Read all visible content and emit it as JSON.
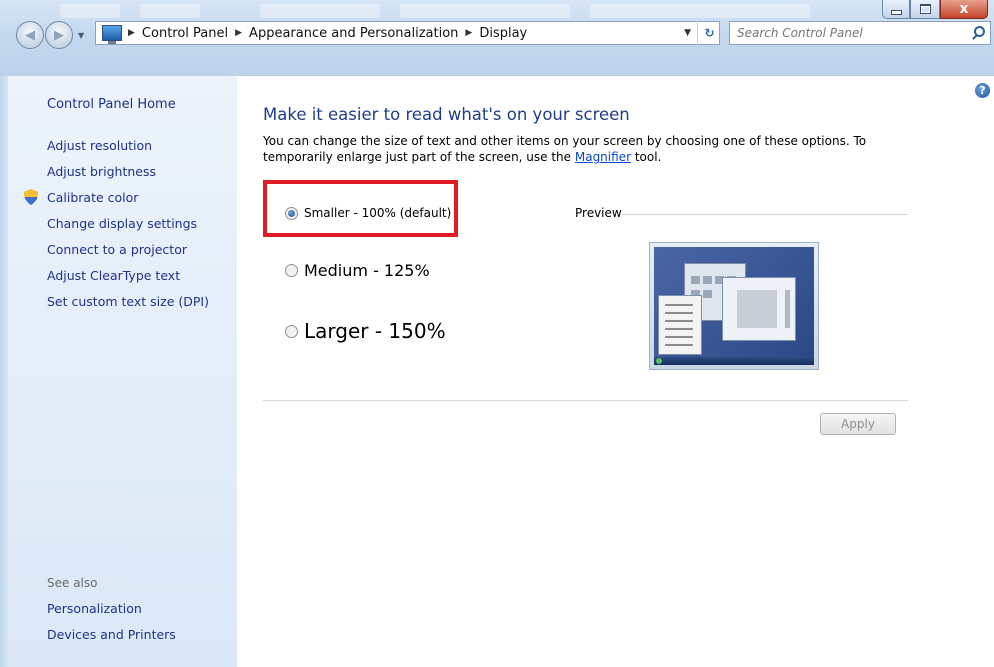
{
  "window": {
    "minimize_label": "",
    "maximize_label": "",
    "close_label": "x"
  },
  "address": {
    "crumbs": [
      "Control Panel",
      "Appearance and Personalization",
      "Display"
    ]
  },
  "search": {
    "placeholder": "Search Control Panel"
  },
  "sidebar": {
    "home": "Control Panel Home",
    "links": [
      "Adjust resolution",
      "Adjust brightness",
      "Calibrate color",
      "Change display settings",
      "Connect to a projector",
      "Adjust ClearType text",
      "Set custom text size (DPI)"
    ],
    "see_also": "See also",
    "bottom_links": [
      "Personalization",
      "Devices and Printers"
    ]
  },
  "main": {
    "title": "Make it easier to read what's on your screen",
    "desc_before": "You can change the size of text and other items on your screen by choosing one of these options. To temporarily enlarge just part of the screen, use the ",
    "desc_link": "Magnifier",
    "desc_after": " tool.",
    "options": [
      {
        "label": "Smaller - 100% (default)",
        "checked": true
      },
      {
        "label": "Medium - 125%",
        "checked": false
      },
      {
        "label": "Larger - 150%",
        "checked": false
      }
    ],
    "preview_label": "Preview",
    "apply_label": "Apply",
    "help_label": "?"
  },
  "colors": {
    "link": "#1e3287",
    "title": "#1e3e8b",
    "highlight": "#e01c24"
  }
}
